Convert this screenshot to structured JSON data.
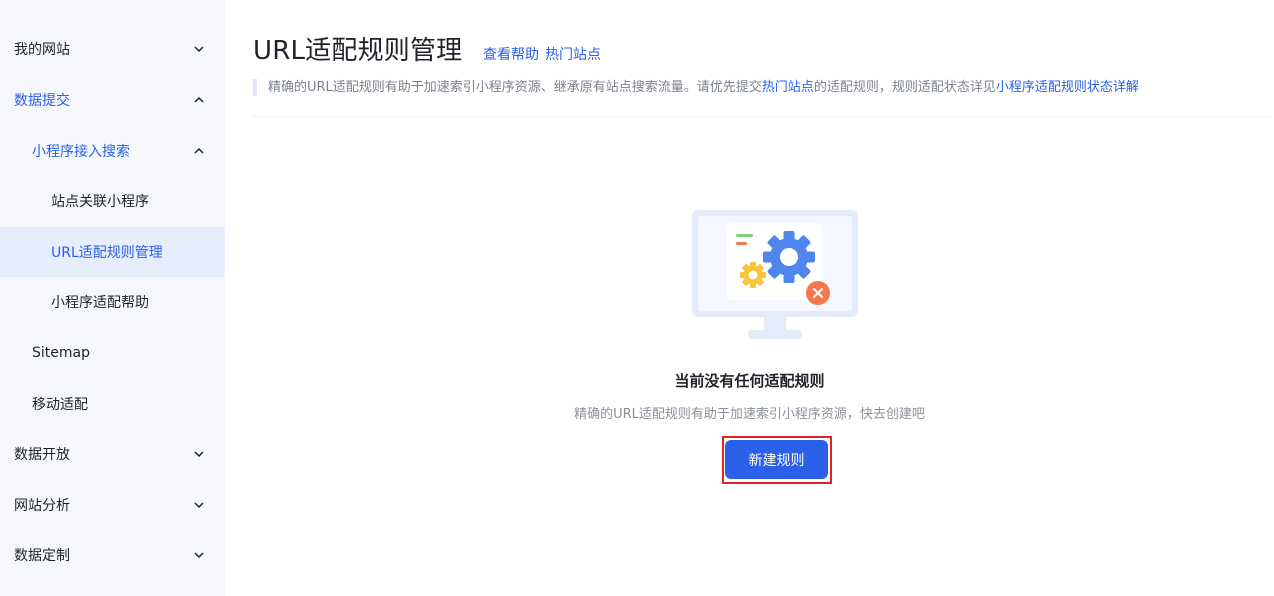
{
  "sidebar": {
    "items": [
      {
        "label": "我的网站"
      },
      {
        "label": "数据提交"
      },
      {
        "label": "小程序接入搜索"
      },
      {
        "label": "站点关联小程序"
      },
      {
        "label": "URL适配规则管理"
      },
      {
        "label": "小程序适配帮助"
      },
      {
        "label": "Sitemap"
      },
      {
        "label": "移动适配"
      },
      {
        "label": "数据开放"
      },
      {
        "label": "网站分析"
      },
      {
        "label": "数据定制"
      }
    ]
  },
  "header": {
    "title": "URL适配规则管理",
    "help_link": "查看帮助",
    "hot_sites_link": "热门站点"
  },
  "notice": {
    "text_1": "精确的URL适配规则有助于加速索引小程序资源、继承原有站点搜索流量。请优先提交",
    "link_1": "热门站点",
    "text_2": "的适配规则，规则适配状态详见",
    "link_2": "小程序适配规则状态详解"
  },
  "empty_state": {
    "icon": "monitor-gear-error-icon",
    "title": "当前没有任何适配规则",
    "description": "精确的URL适配规则有助于加速索引小程序资源，快去创建吧",
    "button_label": "新建规则"
  },
  "colors": {
    "accent": "#2b61e8",
    "sidebar_bg": "#f5f7fb",
    "selected_bg": "#e6edfc",
    "error_orange": "#f5774e",
    "highlight_red": "#e02424"
  }
}
